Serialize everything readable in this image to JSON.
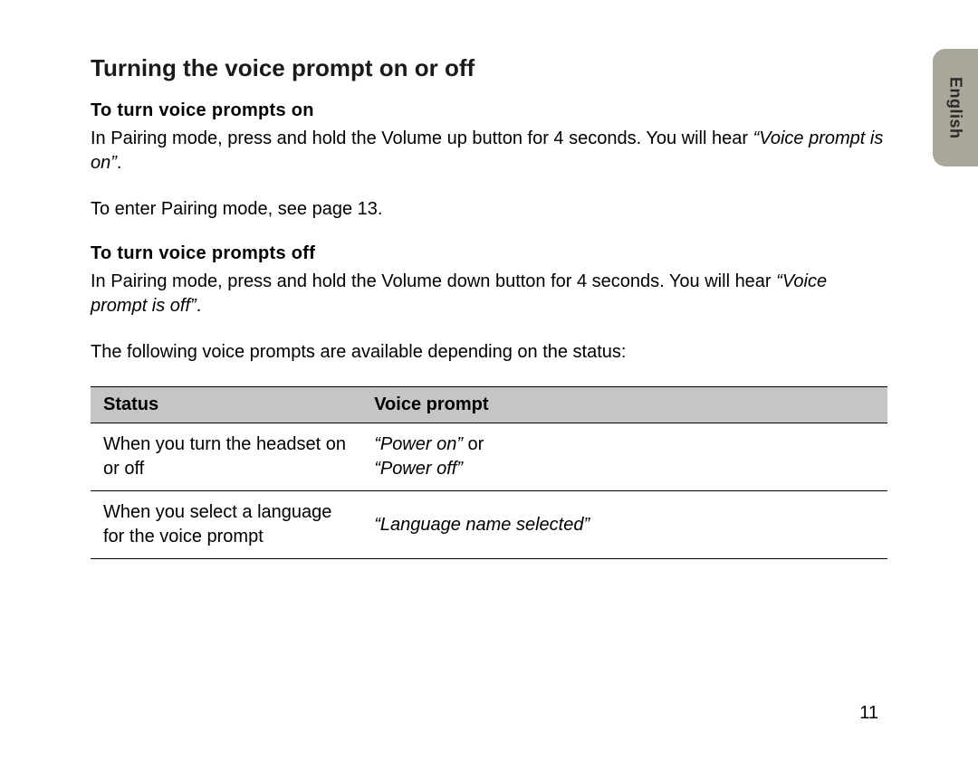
{
  "title": "Turning the voice prompt on or off",
  "section_on": {
    "heading": "To turn voice prompts on",
    "text_before": "In Pairing mode, press and hold the Volume up button for 4 seconds. You will hear ",
    "quote": "“Voice prompt is on”",
    "text_after": "."
  },
  "pairing_note": "To enter Pairing mode, see page 13.",
  "section_off": {
    "heading": "To turn voice prompts off",
    "text_before": "In Pairing mode, press and hold the Volume down button for 4 seconds. You will hear ",
    "quote": "“Voice prompt is off”",
    "text_after": "."
  },
  "table_intro": "The following voice prompts are available depending on the status:",
  "table": {
    "headers": {
      "status": "Status",
      "voice_prompt": "Voice prompt"
    },
    "rows": [
      {
        "status": "When you turn the headset on or off",
        "voice_q1": "“Power on”",
        "voice_mid": " or ",
        "voice_q2": "“Power off”"
      },
      {
        "status": "When you select a language for the voice prompt",
        "voice_q1": "“Language name selected”",
        "voice_mid": "",
        "voice_q2": ""
      }
    ]
  },
  "page_number": "11",
  "lang_tab": "English"
}
